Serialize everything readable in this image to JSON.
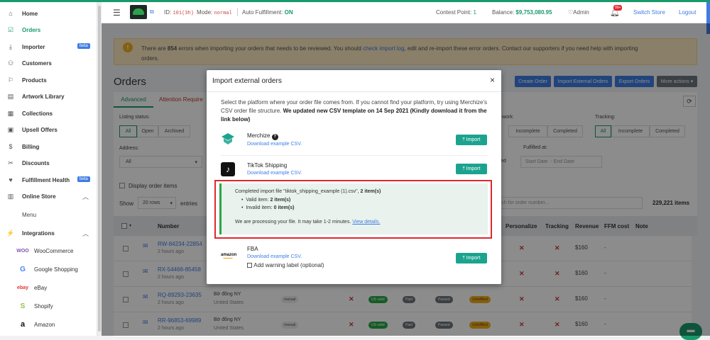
{
  "sidebar": {
    "items": [
      {
        "label": "Home",
        "icon": "home-icon"
      },
      {
        "label": "Orders",
        "icon": "orders-icon"
      },
      {
        "label": "Importer",
        "icon": "download-icon",
        "badge": "beta"
      },
      {
        "label": "Customers",
        "icon": "user-icon"
      },
      {
        "label": "Products",
        "icon": "product-icon"
      },
      {
        "label": "Artwork Library",
        "icon": "book-icon"
      },
      {
        "label": "Collections",
        "icon": "collection-icon"
      },
      {
        "label": "Upsell Offers",
        "icon": "offer-icon"
      },
      {
        "label": "Billing",
        "icon": "dollar-icon"
      },
      {
        "label": "Discounts",
        "icon": "tag-icon"
      },
      {
        "label": "Fulfillment Health",
        "icon": "health-icon",
        "badge": "beta"
      },
      {
        "label": "Online Store",
        "icon": "store-icon"
      },
      {
        "label": "Menu",
        "icon": ""
      },
      {
        "label": "Integrations",
        "icon": "plug-icon"
      }
    ],
    "integrations": [
      {
        "label": "WooCommerce",
        "logo": "WOO"
      },
      {
        "label": "Google Shopping",
        "logo": "G"
      },
      {
        "label": "eBay",
        "logo": "ebay"
      },
      {
        "label": "Shopify",
        "logo": "S"
      },
      {
        "label": "Amazon",
        "logo": "a"
      }
    ]
  },
  "header": {
    "id_label": "ID:",
    "id_value": "101(3h)",
    "mode_label": "Mode:",
    "mode_value": "normal",
    "auto_label": "Auto Fulfillment:",
    "auto_value": "ON",
    "contest_label": "Contest Point:",
    "contest_value": "1",
    "balance_label": "Balance:",
    "balance_value": "$9,753,080.95",
    "admin": "Admin",
    "notif_count": "99+",
    "switch_store": "Switch Store",
    "logout": "Logout"
  },
  "alert": {
    "pre": "There are ",
    "count": "854",
    "mid": " errors when importing your orders that needs to be reviewed. You should ",
    "link": "check import log",
    "post": ", edit and re-import these error orders. Contact our supporters if you need help with importing",
    "line2": "orders."
  },
  "page": {
    "title": "Orders",
    "tabs": [
      "Advanced",
      "Attention Require"
    ],
    "buttons": {
      "create": "Create Order",
      "import_ext": "Import External Orders",
      "export": "Export Orders",
      "more": "More actions"
    },
    "listing_label": "Listing status:",
    "listing_options": [
      "All",
      "Open",
      "Archived"
    ],
    "work_label": "work:",
    "work_options": [
      "Incomplete",
      "Completed"
    ],
    "tracking_label": "Tracking:",
    "tracking_options": [
      "All",
      "Incomplete",
      "Completed"
    ],
    "address_label": "Address:",
    "address_value": "All",
    "fulfilled_label": "Fulfilled at:",
    "date_start": "Start Date",
    "date_sep": "-",
    "date_end": "End Date",
    "ed_text": "ed",
    "display_items": "Display order items",
    "show_label": "Show",
    "show_value": "20 rows",
    "entries": "entries",
    "search_placeholder": "rch for order number...",
    "total_items": "229,221 items",
    "table_headers": {
      "number": "Number",
      "personalize": "Personalize",
      "tracking": "Tracking",
      "revenue": "Revenue",
      "ffm_cost": "FFM cost",
      "note": "Note"
    }
  },
  "rows": [
    {
      "number": "RW-84234-22854",
      "time": "2 hours ago",
      "revenue": "$160",
      "dash": "-"
    },
    {
      "number": "RX-54466-85458",
      "time": "2 hours ago",
      "revenue": "$160",
      "dash": "-"
    },
    {
      "number": "RQ-89293-23635",
      "time": "2 hours ago",
      "customer": "Bờ đông NY",
      "country": "United States",
      "tag": "manual",
      "us": "US valid",
      "paid": "Paid",
      "passed": "Passed",
      "status": "Unfulfilled",
      "revenue": "$160",
      "dash": "-"
    },
    {
      "number": "RR-96853-69989",
      "time": "2 hours ago",
      "customer": "Bờ đông NY",
      "country": "United States",
      "tag": "manual",
      "us": "US valid",
      "paid": "Paid",
      "passed": "Passed",
      "status": "Unfulfilled",
      "revenue": "$160",
      "dash": "-"
    }
  ],
  "modal": {
    "title": "Import external orders",
    "close": "×",
    "desc_plain": "Select the platform where your order file comes from. If you cannot find your platform, try using Merchize's CSV order file structure. ",
    "desc_bold": "We updated new CSV template on 14 Sep 2021 (Kindly download it from the link below)",
    "platforms": [
      {
        "name": "Merchize",
        "link": "Download example CSV.",
        "button": "Import"
      },
      {
        "name": "TikTok Shipping",
        "link": "Download example CSV.",
        "button": "Import"
      },
      {
        "name": "FBA",
        "link": "Download example CSV.",
        "button": "Import",
        "extra": "Add warning label (optional)"
      }
    ],
    "result": {
      "completed_pre": "Completed import file \"tiktok_shipping_example (1).csv\", ",
      "completed_count": "2 item(s)",
      "valid_label": "Valid item: ",
      "valid_value": "2 item(s)",
      "invalid_label": "Invalid item: ",
      "invalid_value": "0 item(s)",
      "processing": "We are processing your file. It may take 1-2 minutes. ",
      "details_link": "View details."
    },
    "amazon_logo": "amazon"
  },
  "colors": {
    "brand": "#1a9a6c",
    "teal_button": "#1ca38f",
    "blue_button": "#3f7ce4",
    "highlight_border": "#e0282e"
  }
}
